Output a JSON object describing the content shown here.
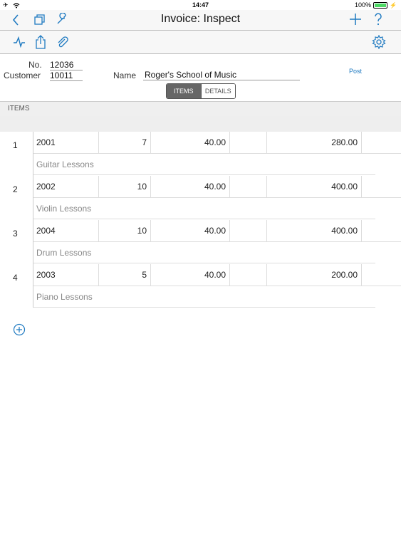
{
  "status": {
    "time": "14:47",
    "battery": "100%"
  },
  "nav": {
    "title": "Invoice: Inspect"
  },
  "header": {
    "no_label": "No.",
    "no_value": "12036",
    "customer_label": "Customer",
    "customer_value": "10011",
    "name_label": "Name",
    "name_value": "Roger's School of Music",
    "post_link": "Post"
  },
  "tabs": {
    "items": "ITEMS",
    "details": "DETAILS"
  },
  "section": {
    "title": "ITEMS"
  },
  "items": [
    {
      "index": "1",
      "code": "2001",
      "qty": "7",
      "price": "40.00",
      "amount": "280.00",
      "desc": "Guitar Lessons"
    },
    {
      "index": "2",
      "code": "2002",
      "qty": "10",
      "price": "40.00",
      "amount": "400.00",
      "desc": "Violin Lessons"
    },
    {
      "index": "3",
      "code": "2004",
      "qty": "10",
      "price": "40.00",
      "amount": "400.00",
      "desc": "Drum Lessons"
    },
    {
      "index": "4",
      "code": "2003",
      "qty": "5",
      "price": "40.00",
      "amount": "200.00",
      "desc": "Piano Lessons"
    }
  ],
  "colors": {
    "accent": "#1f7ac1",
    "active_tab": "#666666"
  }
}
